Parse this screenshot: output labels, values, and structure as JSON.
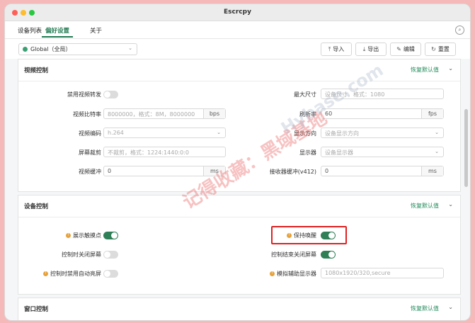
{
  "window": {
    "title": "Escrcpy"
  },
  "tabs": [
    "设备列表",
    "偏好设置",
    "关于"
  ],
  "toolbar": {
    "scope_select": "Global（全局）",
    "buttons": [
      {
        "icon": "import-icon",
        "label": "导入"
      },
      {
        "icon": "export-icon",
        "label": "导出"
      },
      {
        "icon": "edit-icon",
        "label": "编辑"
      },
      {
        "icon": "reset-icon",
        "label": "重置"
      }
    ]
  },
  "video": {
    "title": "视频控制",
    "restore": "恢复默认值",
    "labels": {
      "forward": "禁用视频转发",
      "bitrate": "视频比特率",
      "codec": "视频编码",
      "crop": "屏幕裁剪",
      "buffer": "视频缓冲",
      "maxsize": "最大尺寸",
      "fps": "刷新率",
      "orientation": "显示方向",
      "display": "显示器",
      "rbuffer": "接收器缓冲(v412)"
    },
    "fields": {
      "bitrate_placeholder": "8000000，格式：8M，8000000",
      "bitrate_unit": "bps",
      "codec_value": "h.264",
      "crop_placeholder": "不裁剪，格式：1224:1440:0:0",
      "buffer_value": "0",
      "buffer_unit": "ms",
      "maxsize_placeholder": "设备尺寸，格式：1080",
      "fps_value": "60",
      "fps_unit": "fps",
      "orientation_placeholder": "设备显示方向",
      "display_placeholder": "设备显示器",
      "rbuffer_value": "0",
      "rbuffer_unit": "ms"
    }
  },
  "device": {
    "title": "设备控制",
    "restore": "恢复默认值",
    "labels": {
      "touches": "展示触摸点",
      "off_on_control": "控制时关闭屏幕",
      "no_sleep": "控制时禁用自动亮屏",
      "stay_awake": "保持唤醒",
      "off_on_close": "控制结束关闭屏幕",
      "virtual_display": "模拟辅助显示器"
    },
    "virtual_display_placeholder": "1080x1920/320,secure"
  },
  "window_section": {
    "title": "窗口控制",
    "restore": "恢复默认值"
  },
  "watermark": "记得收藏：黑域基地",
  "watermark2": "Hybase.com",
  "colors": {
    "accent": "#1f7a52",
    "highlight": "#e02020",
    "warning": "#e6a23c"
  }
}
